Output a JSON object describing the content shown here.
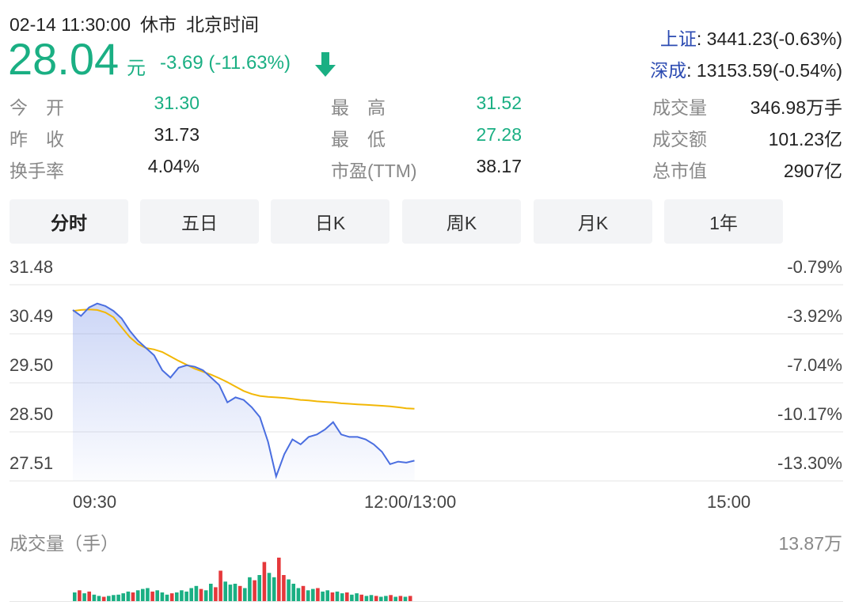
{
  "header": {
    "datetime": "02-14 11:30:00",
    "status": "休市",
    "timezone": "北京时间",
    "price": "28.04",
    "currency": "元",
    "change": "-3.69 (-11.63%)",
    "arrow": "down-arrow-icon"
  },
  "indices": [
    {
      "name": "上证",
      "value": ": 3441.23(-0.63%)"
    },
    {
      "name": "深成",
      "value": ": 13153.59(-0.54%)"
    }
  ],
  "stats": {
    "open": {
      "label": "今　开",
      "value": "31.30"
    },
    "prev": {
      "label": "昨　收",
      "value": "31.73"
    },
    "turnover": {
      "label": "换手率",
      "value": "4.04%"
    },
    "high": {
      "label": "最　高",
      "value": "31.52"
    },
    "low": {
      "label": "最　低",
      "value": "27.28"
    },
    "pe": {
      "label": "市盈(TTM)",
      "value": "38.17"
    },
    "volume": {
      "label": "成交量",
      "value": "346.98万手"
    },
    "amount": {
      "label": "成交额",
      "value": "101.23亿"
    },
    "mktcap": {
      "label": "总市值",
      "value": "2907亿"
    }
  },
  "tabs": [
    "分时",
    "五日",
    "日K",
    "周K",
    "月K",
    "1年"
  ],
  "active_tab": 0,
  "colors": {
    "up": "#e5383b",
    "down": "#1aaf83",
    "price_line": "#4a6ee0",
    "avg_line": "#f2b705",
    "index_name": "#2c4bb2"
  },
  "chart_data": {
    "type": "line",
    "y_left_ticks": [
      "31.48",
      "30.49",
      "29.50",
      "28.50",
      "27.51"
    ],
    "y_right_ticks": [
      "-0.79%",
      "-3.92%",
      "-7.04%",
      "-10.17%",
      "-13.30%"
    ],
    "x_ticks": [
      "09:30",
      "12:00/13:00",
      "15:00"
    ],
    "ylim": [
      27.51,
      31.48
    ],
    "x_range_minutes": 240,
    "series": [
      {
        "role": "price",
        "values": [
          30.97,
          30.85,
          31.02,
          31.1,
          31.05,
          30.95,
          30.8,
          30.55,
          30.35,
          30.2,
          30.05,
          29.75,
          29.6,
          29.8,
          29.85,
          29.82,
          29.75,
          29.6,
          29.45,
          29.1,
          29.2,
          29.15,
          29.0,
          28.8,
          28.3,
          27.6,
          28.05,
          28.35,
          28.25,
          28.4,
          28.45,
          28.55,
          28.7,
          28.45,
          28.4,
          28.4,
          28.35,
          28.25,
          28.1,
          27.85,
          27.9,
          27.88,
          27.92
        ]
      },
      {
        "role": "average",
        "values": [
          30.95,
          30.97,
          30.98,
          30.97,
          30.92,
          30.82,
          30.62,
          30.42,
          30.28,
          30.2,
          30.17,
          30.12,
          30.03,
          29.94,
          29.86,
          29.78,
          29.72,
          29.66,
          29.59,
          29.51,
          29.42,
          29.33,
          29.27,
          29.23,
          29.21,
          29.2,
          29.19,
          29.17,
          29.15,
          29.14,
          29.12,
          29.11,
          29.1,
          29.08,
          29.07,
          29.06,
          29.05,
          29.04,
          29.03,
          29.02,
          29.0,
          28.98,
          28.97
        ]
      }
    ]
  },
  "volume_chart": {
    "title": "成交量（手）",
    "max_label": "13.87万",
    "bars": [
      {
        "v": 0.2,
        "c": "down"
      },
      {
        "v": 0.25,
        "c": "up"
      },
      {
        "v": 0.18,
        "c": "down"
      },
      {
        "v": 0.22,
        "c": "up"
      },
      {
        "v": 0.15,
        "c": "down"
      },
      {
        "v": 0.12,
        "c": "down"
      },
      {
        "v": 0.1,
        "c": "up"
      },
      {
        "v": 0.12,
        "c": "down"
      },
      {
        "v": 0.14,
        "c": "down"
      },
      {
        "v": 0.15,
        "c": "down"
      },
      {
        "v": 0.18,
        "c": "down"
      },
      {
        "v": 0.22,
        "c": "down"
      },
      {
        "v": 0.2,
        "c": "up"
      },
      {
        "v": 0.25,
        "c": "down"
      },
      {
        "v": 0.28,
        "c": "down"
      },
      {
        "v": 0.3,
        "c": "down"
      },
      {
        "v": 0.22,
        "c": "up"
      },
      {
        "v": 0.25,
        "c": "down"
      },
      {
        "v": 0.2,
        "c": "down"
      },
      {
        "v": 0.15,
        "c": "down"
      },
      {
        "v": 0.18,
        "c": "up"
      },
      {
        "v": 0.2,
        "c": "down"
      },
      {
        "v": 0.25,
        "c": "down"
      },
      {
        "v": 0.22,
        "c": "down"
      },
      {
        "v": 0.3,
        "c": "down"
      },
      {
        "v": 0.35,
        "c": "down"
      },
      {
        "v": 0.28,
        "c": "up"
      },
      {
        "v": 0.25,
        "c": "down"
      },
      {
        "v": 0.4,
        "c": "down"
      },
      {
        "v": 0.32,
        "c": "up"
      },
      {
        "v": 0.7,
        "c": "up"
      },
      {
        "v": 0.45,
        "c": "down"
      },
      {
        "v": 0.38,
        "c": "down"
      },
      {
        "v": 0.4,
        "c": "down"
      },
      {
        "v": 0.35,
        "c": "up"
      },
      {
        "v": 0.3,
        "c": "down"
      },
      {
        "v": 0.55,
        "c": "down"
      },
      {
        "v": 0.48,
        "c": "up"
      },
      {
        "v": 0.6,
        "c": "down"
      },
      {
        "v": 0.9,
        "c": "up"
      },
      {
        "v": 0.65,
        "c": "down"
      },
      {
        "v": 0.55,
        "c": "down"
      },
      {
        "v": 1.0,
        "c": "up"
      },
      {
        "v": 0.6,
        "c": "up"
      },
      {
        "v": 0.5,
        "c": "down"
      },
      {
        "v": 0.4,
        "c": "down"
      },
      {
        "v": 0.3,
        "c": "down"
      },
      {
        "v": 0.35,
        "c": "up"
      },
      {
        "v": 0.25,
        "c": "down"
      },
      {
        "v": 0.28,
        "c": "down"
      },
      {
        "v": 0.3,
        "c": "up"
      },
      {
        "v": 0.22,
        "c": "down"
      },
      {
        "v": 0.25,
        "c": "down"
      },
      {
        "v": 0.2,
        "c": "up"
      },
      {
        "v": 0.22,
        "c": "down"
      },
      {
        "v": 0.18,
        "c": "down"
      },
      {
        "v": 0.2,
        "c": "up"
      },
      {
        "v": 0.15,
        "c": "down"
      },
      {
        "v": 0.18,
        "c": "down"
      },
      {
        "v": 0.15,
        "c": "up"
      },
      {
        "v": 0.12,
        "c": "down"
      },
      {
        "v": 0.14,
        "c": "down"
      },
      {
        "v": 0.12,
        "c": "up"
      },
      {
        "v": 0.1,
        "c": "down"
      },
      {
        "v": 0.12,
        "c": "down"
      },
      {
        "v": 0.14,
        "c": "up"
      },
      {
        "v": 0.1,
        "c": "down"
      },
      {
        "v": 0.12,
        "c": "up"
      },
      {
        "v": 0.1,
        "c": "down"
      },
      {
        "v": 0.12,
        "c": "up"
      }
    ]
  }
}
